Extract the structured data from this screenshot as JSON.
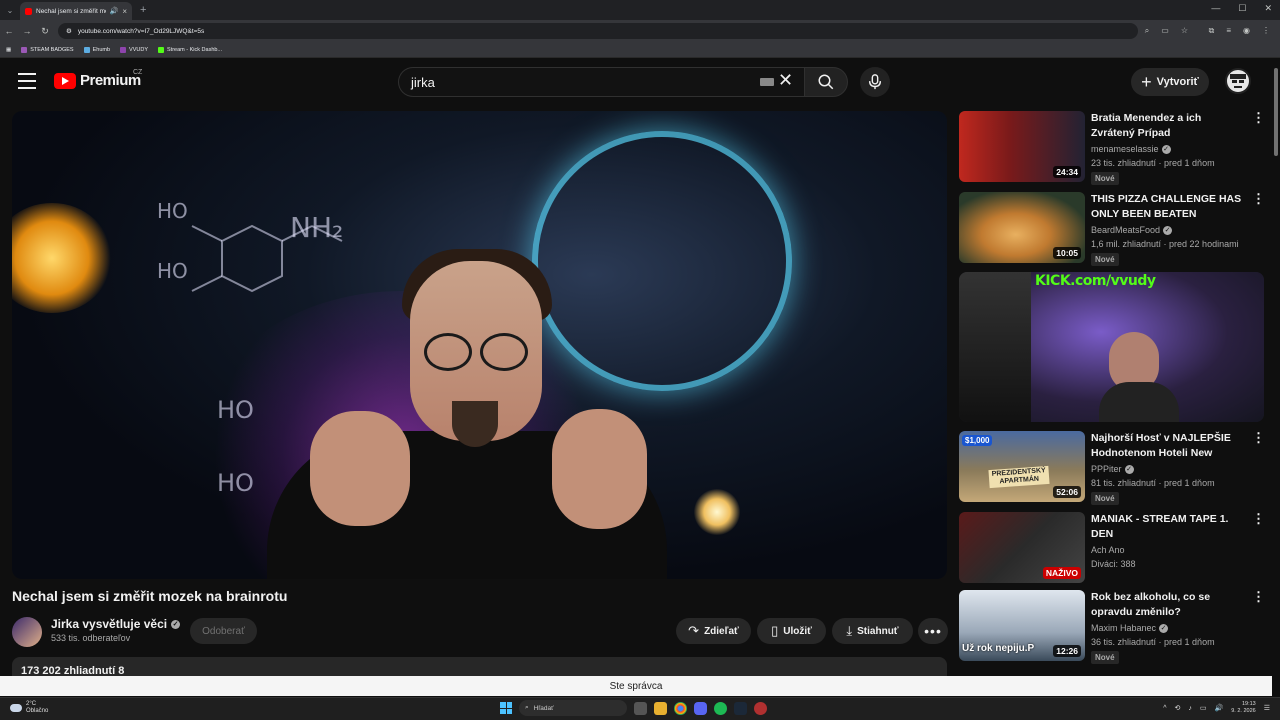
{
  "browser": {
    "tab_title": "Nechal jsem si změřit mozek",
    "url": "youtube.com/watch?v=I7_Od29LJWQ&t=5s",
    "bookmarks": [
      {
        "label": "STEAM BADGES",
        "color": "#9b59b6"
      },
      {
        "label": "Ehumb",
        "color": "#5dade2"
      },
      {
        "label": "VVUDY",
        "color": "#8e44ad"
      },
      {
        "label": "Stream - Kick Dashb...",
        "color": "#53fc18"
      }
    ]
  },
  "header": {
    "logo_text": "Premium",
    "country": "CZ",
    "search_value": "jirka",
    "create_label": "Vytvoriť"
  },
  "video": {
    "title": "Nechal jsem si změřit mozek na brainrotu",
    "channel": "Jirka vysvětluje věci",
    "subscribers": "533 tis. odberateľov",
    "subscribe_label": "Odoberať",
    "share_label": "Zdieľať",
    "save_label": "Uložiť",
    "download_label": "Stiahnuť",
    "views": "173 202 zhliadnutí  8"
  },
  "recommendations": [
    {
      "title": "Bratia Menendez a ich Zvrátený Prípad",
      "channel": "menameselassie",
      "verified": true,
      "meta": "23 tis. zhliadnutí · pred 1 dňom",
      "duration": "24:34",
      "badge": "Nové",
      "thumb": "#7a1a1a"
    },
    {
      "title": "THIS PIZZA CHALLENGE HAS ONLY BEEN BEATEN ONCE...B...",
      "channel": "BeardMeatsFood",
      "verified": true,
      "meta": "1,6 mil. zhliadnutí · pred 22 hodinami",
      "duration": "10:05",
      "badge": "Nové",
      "thumb": "#b07030"
    },
    {
      "title": "Najhorší Hosť v NAJLEPŠIE Hodnotenom Hoteli New York...",
      "channel": "PPPiter",
      "verified": true,
      "meta": "81 tis. zhliadnutí · pred 1 dňom",
      "duration": "52:06",
      "badge": "Nové",
      "thumb": "#6a5a40"
    },
    {
      "title": "MANIAK - STREAM TAPE 1. DEN",
      "channel": "Ach Ano",
      "verified": false,
      "meta": "Diváci: 388",
      "duration": "NAŽIVO",
      "badge": "",
      "thumb": "#3a2a2a"
    },
    {
      "title": "Rok bez alkoholu, co se opravdu změnilo?",
      "channel": "Maxim Habanec",
      "verified": true,
      "meta": "36 tis. zhliadnutí · pred 1 dňom",
      "duration": "12:26",
      "badge": "Nové",
      "thumb": "#2a4a6a"
    }
  ],
  "ad": {
    "text": "KICK.com/vvudy",
    "accent": "#53fc18"
  },
  "thumb_texts": {
    "pppiter_price": "$1,000",
    "pppiter_caption": "PREZIDENTSKÝ APARTMÁN",
    "habanec_caption": "Už rok nepiju.P"
  },
  "admin_bar": "Ste správca",
  "taskbar": {
    "weather_temp": "2°C",
    "weather_desc": "Oblačno",
    "search_placeholder": "Hľadať",
    "time": "19:13",
    "date": "9. 2. 2026"
  }
}
